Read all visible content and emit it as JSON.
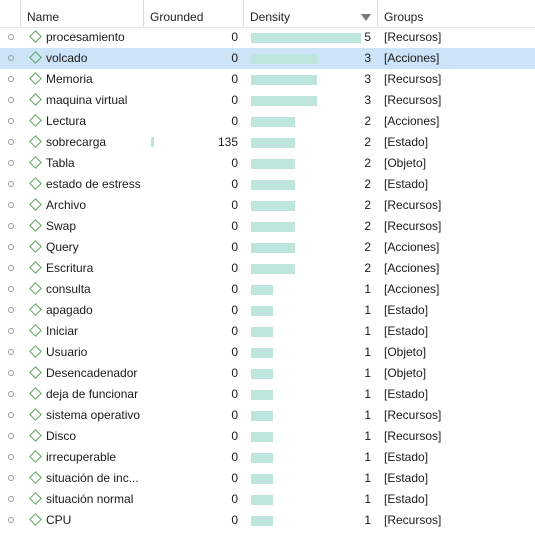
{
  "columns": {
    "name": "Name",
    "grounded": "Grounded",
    "density": "Density",
    "groups": "Groups"
  },
  "rows": [
    {
      "name": "procesamiento",
      "grounded": 0,
      "density": 5,
      "group": "[Recursos]",
      "selected": false
    },
    {
      "name": "volcado",
      "grounded": 0,
      "density": 3,
      "group": "[Acciones]",
      "selected": true
    },
    {
      "name": "Memoria",
      "grounded": 0,
      "density": 3,
      "group": "[Recursos]",
      "selected": false
    },
    {
      "name": "maquina virtual",
      "grounded": 0,
      "density": 3,
      "group": "[Recursos]",
      "selected": false
    },
    {
      "name": "Lectura",
      "grounded": 0,
      "density": 2,
      "group": "[Acciones]",
      "selected": false
    },
    {
      "name": "sobrecarga",
      "grounded": 135,
      "density": 2,
      "group": "[Estado]",
      "selected": false
    },
    {
      "name": "Tabla",
      "grounded": 0,
      "density": 2,
      "group": "[Objeto]",
      "selected": false
    },
    {
      "name": "estado de estress",
      "grounded": 0,
      "density": 2,
      "group": "[Estado]",
      "selected": false
    },
    {
      "name": "Archivo",
      "grounded": 0,
      "density": 2,
      "group": "[Recursos]",
      "selected": false
    },
    {
      "name": "Swap",
      "grounded": 0,
      "density": 2,
      "group": "[Recursos]",
      "selected": false
    },
    {
      "name": "Query",
      "grounded": 0,
      "density": 2,
      "group": "[Acciones]",
      "selected": false
    },
    {
      "name": "Escritura",
      "grounded": 0,
      "density": 2,
      "group": "[Acciones]",
      "selected": false
    },
    {
      "name": "consulta",
      "grounded": 0,
      "density": 1,
      "group": "[Acciones]",
      "selected": false
    },
    {
      "name": "apagado",
      "grounded": 0,
      "density": 1,
      "group": "[Estado]",
      "selected": false
    },
    {
      "name": "Iniciar",
      "grounded": 0,
      "density": 1,
      "group": "[Estado]",
      "selected": false
    },
    {
      "name": "Usuario",
      "grounded": 0,
      "density": 1,
      "group": "[Objeto]",
      "selected": false
    },
    {
      "name": "Desencadenador",
      "grounded": 0,
      "density": 1,
      "group": "[Objeto]",
      "selected": false
    },
    {
      "name": "deja de funcionar",
      "grounded": 0,
      "density": 1,
      "group": "[Estado]",
      "selected": false
    },
    {
      "name": "sistema operativo",
      "grounded": 0,
      "density": 1,
      "group": "[Recursos]",
      "selected": false
    },
    {
      "name": "Disco",
      "grounded": 0,
      "density": 1,
      "group": "[Recursos]",
      "selected": false
    },
    {
      "name": "irrecuperable",
      "grounded": 0,
      "density": 1,
      "group": "[Estado]",
      "selected": false
    },
    {
      "name": "situación de inc...",
      "grounded": 0,
      "density": 1,
      "group": "[Estado]",
      "selected": false
    },
    {
      "name": "situación normal",
      "grounded": 0,
      "density": 1,
      "group": "[Estado]",
      "selected": false
    },
    {
      "name": "CPU",
      "grounded": 0,
      "density": 1,
      "group": "[Recursos]",
      "selected": false
    }
  ],
  "colors": {
    "bar": "#bfe6dc",
    "selected_row": "#cde3f7",
    "code_icon": "#5aa55a"
  },
  "icons": {
    "row_marker": "circle-bullet-icon",
    "code": "code-diamond-icon",
    "sort": "sort-descending-icon"
  }
}
